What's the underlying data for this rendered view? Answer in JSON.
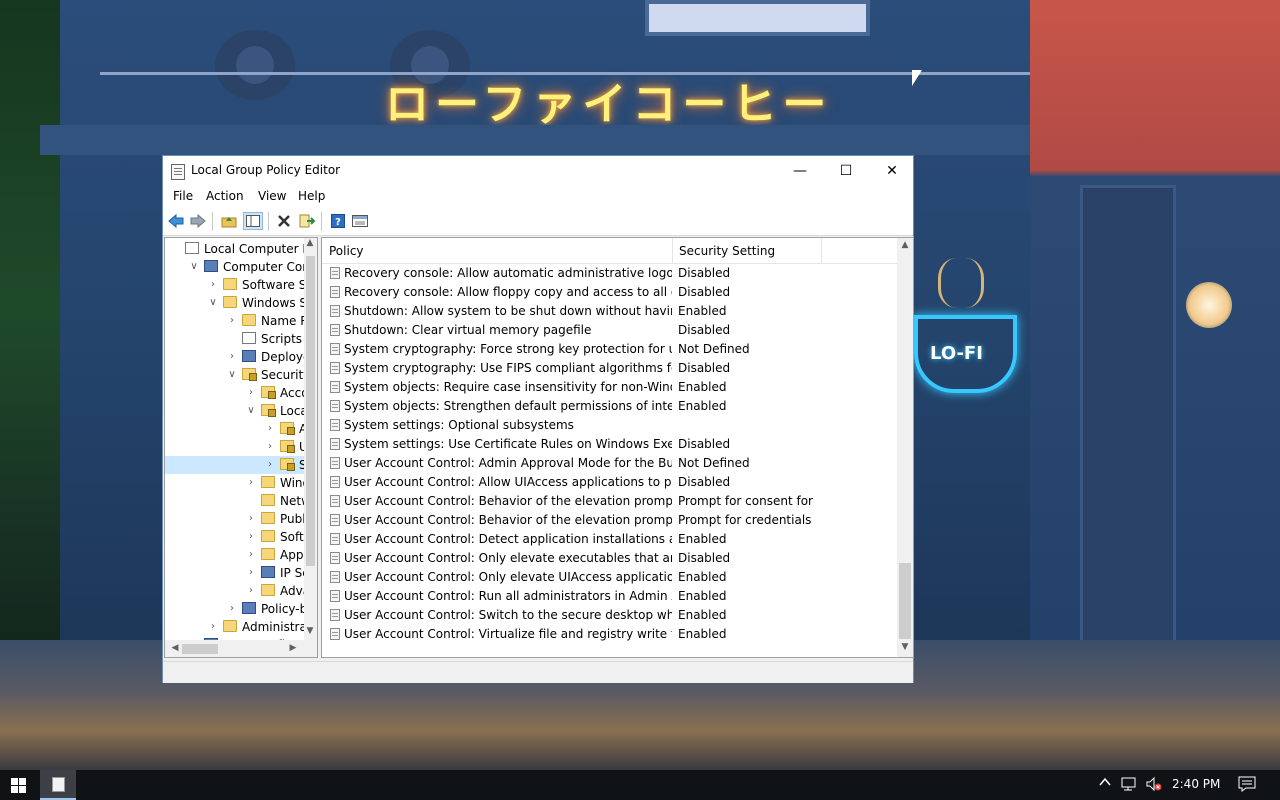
{
  "window": {
    "title": "Local Group Policy Editor",
    "controls": {
      "minimize": "—",
      "maximize": "☐",
      "close": "✕"
    }
  },
  "menu": [
    "File",
    "Action",
    "View",
    "Help"
  ],
  "toolbar_icons": [
    "back-arrow-icon",
    "forward-arrow-icon",
    "up-folder-icon",
    "show-hide-tree-icon",
    "delete-icon",
    "export-list-icon",
    "help-icon",
    "properties-view-icon"
  ],
  "tree": {
    "items": [
      {
        "label": "Local Computer Polic",
        "level": 0,
        "expander": "",
        "icon": "policy-doc-icon"
      },
      {
        "label": "Computer Configu",
        "level": 1,
        "expander": "expanded",
        "icon": "computer-icon"
      },
      {
        "label": "Software Setti",
        "level": 2,
        "expander": "collapsed",
        "icon": "folder-icon"
      },
      {
        "label": "Windows Sett",
        "level": 2,
        "expander": "expanded",
        "icon": "folder-icon"
      },
      {
        "label": "Name Res",
        "level": 3,
        "expander": "collapsed",
        "icon": "folder-icon"
      },
      {
        "label": "Scripts (Sta",
        "level": 3,
        "expander": "",
        "icon": "scripts-icon"
      },
      {
        "label": "Deployed",
        "level": 3,
        "expander": "collapsed",
        "icon": "printer-icon"
      },
      {
        "label": "Security Se",
        "level": 3,
        "expander": "expanded",
        "icon": "security-folder-icon"
      },
      {
        "label": "Accou",
        "level": 4,
        "expander": "collapsed",
        "icon": "security-folder-icon"
      },
      {
        "label": "Local P",
        "level": 4,
        "expander": "expanded",
        "icon": "security-folder-icon"
      },
      {
        "label": "Au",
        "level": 5,
        "expander": "collapsed",
        "icon": "security-folder-icon"
      },
      {
        "label": "Use",
        "level": 5,
        "expander": "collapsed",
        "icon": "security-folder-icon"
      },
      {
        "label": "Sec",
        "level": 5,
        "expander": "collapsed",
        "icon": "security-folder-icon",
        "selected": true
      },
      {
        "label": "Windo",
        "level": 4,
        "expander": "collapsed",
        "icon": "folder-icon"
      },
      {
        "label": "Netwo",
        "level": 4,
        "expander": "",
        "icon": "folder-icon"
      },
      {
        "label": "Public",
        "level": 4,
        "expander": "collapsed",
        "icon": "folder-icon"
      },
      {
        "label": "Softwa",
        "level": 4,
        "expander": "collapsed",
        "icon": "folder-icon"
      },
      {
        "label": "Applic",
        "level": 4,
        "expander": "collapsed",
        "icon": "folder-icon"
      },
      {
        "label": "IP Secu",
        "level": 4,
        "expander": "collapsed",
        "icon": "ip-security-icon"
      },
      {
        "label": "Advan",
        "level": 4,
        "expander": "collapsed",
        "icon": "folder-icon"
      },
      {
        "label": "Policy-bas",
        "level": 3,
        "expander": "collapsed",
        "icon": "chart-icon"
      },
      {
        "label": "Administrative",
        "level": 2,
        "expander": "collapsed",
        "icon": "folder-icon"
      },
      {
        "label": "User Configuration",
        "level": 1,
        "expander": "collapsed",
        "icon": "user-icon"
      }
    ]
  },
  "list": {
    "columns": {
      "policy": "Policy",
      "setting": "Security Setting"
    },
    "sort_indicator": "^",
    "rows": [
      {
        "policy": "Recovery console: Allow automatic administrative logon",
        "setting": "Disabled"
      },
      {
        "policy": "Recovery console: Allow floppy copy and access to all drives...",
        "setting": "Disabled"
      },
      {
        "policy": "Shutdown: Allow system to be shut down without having to...",
        "setting": "Enabled"
      },
      {
        "policy": "Shutdown: Clear virtual memory pagefile",
        "setting": "Disabled"
      },
      {
        "policy": "System cryptography: Force strong key protection for user k...",
        "setting": "Not Defined"
      },
      {
        "policy": "System cryptography: Use FIPS compliant algorithms for en...",
        "setting": "Disabled"
      },
      {
        "policy": "System objects: Require case insensitivity for non-Windows ...",
        "setting": "Enabled"
      },
      {
        "policy": "System objects: Strengthen default permissions of internal s...",
        "setting": "Enabled"
      },
      {
        "policy": "System settings: Optional subsystems",
        "setting": ""
      },
      {
        "policy": "System settings: Use Certificate Rules on Windows Executab...",
        "setting": "Disabled"
      },
      {
        "policy": "User Account Control: Admin Approval Mode for the Built-i...",
        "setting": "Not Defined"
      },
      {
        "policy": "User Account Control: Allow UIAccess applications to prom...",
        "setting": "Disabled"
      },
      {
        "policy": "User Account Control: Behavior of the elevation prompt for ...",
        "setting": "Prompt for consent for ..."
      },
      {
        "policy": "User Account Control: Behavior of the elevation prompt for ...",
        "setting": "Prompt for credentials"
      },
      {
        "policy": "User Account Control: Detect application installations and p...",
        "setting": "Enabled"
      },
      {
        "policy": "User Account Control: Only elevate executables that are sig...",
        "setting": "Disabled"
      },
      {
        "policy": "User Account Control: Only elevate UIAccess applications th...",
        "setting": "Enabled"
      },
      {
        "policy": "User Account Control: Run all administrators in Admin Appr...",
        "setting": "Enabled"
      },
      {
        "policy": "User Account Control: Switch to the secure desktop when pr...",
        "setting": "Enabled"
      },
      {
        "policy": "User Account Control: Virtualize file and registry write failure...",
        "setting": "Enabled"
      }
    ]
  },
  "wallpaper": {
    "neon_sign": "ローファイコーヒー",
    "cup_sign": "LO-FI"
  },
  "taskbar": {
    "clock": "2:40 PM",
    "tray_icons": [
      "show-hidden-icons-chevron",
      "network-icon",
      "volume-muted-icon",
      "action-center-icon"
    ]
  }
}
